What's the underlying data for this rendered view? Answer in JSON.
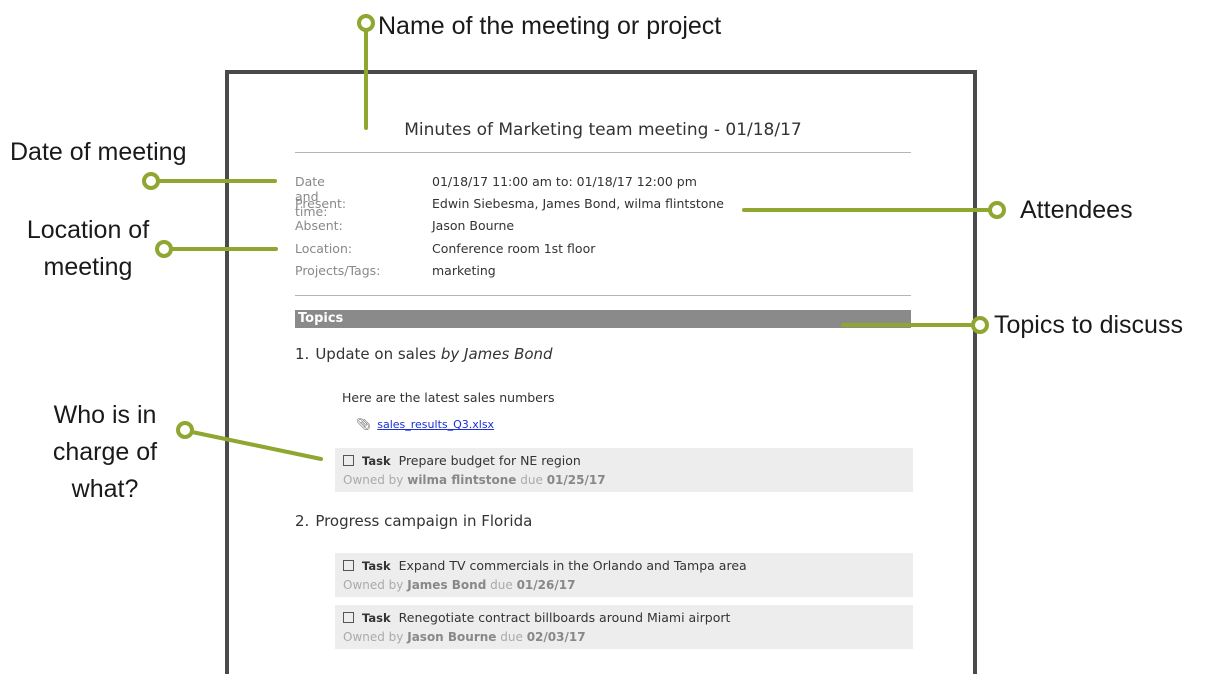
{
  "callouts": {
    "name": "Name of the meeting or project",
    "date": "Date of meeting",
    "location_line1": "Location of",
    "location_line2": "meeting",
    "attendees": "Attendees",
    "topics": "Topics to discuss",
    "who_line1": "Who is in",
    "who_line2": "charge of",
    "who_line3": "what?"
  },
  "colors": {
    "accent": "#8fa631",
    "frame": "#4a4a4a",
    "topics_bar": "#8a8a8a",
    "link": "#1a2fd6"
  },
  "document": {
    "title": "Minutes of Marketing team meeting - 01/18/17",
    "meta": [
      {
        "key": "Date and time:",
        "value": "01/18/17 11:00 am to: 01/18/17 12:00 pm"
      },
      {
        "key": "Present:",
        "value": "Edwin Siebesma, James Bond, wilma flintstone"
      },
      {
        "key": "Absent:",
        "value": "Jason Bourne"
      },
      {
        "key": "Location:",
        "value": "Conference room 1st floor"
      },
      {
        "key": "Projects/Tags:",
        "value": "marketing"
      }
    ],
    "topics_header": "Topics",
    "topics": [
      {
        "number": "1.",
        "title": "Update on sales",
        "by": "by James Bond"
      },
      {
        "number": "2.",
        "title": "Progress campaign in Florida"
      }
    ],
    "note": "Here are the latest sales numbers",
    "attachment": {
      "icon": "paperclip-icon",
      "filename": "sales_results_Q3.xlsx"
    },
    "tasks": [
      {
        "kind": "Task",
        "text": "Prepare budget for NE region",
        "owned_label": "Owned by",
        "owner": "wilma flintstone",
        "due_label": "due",
        "due": "01/25/17"
      },
      {
        "kind": "Task",
        "text": "Expand TV commercials in the Orlando and Tampa area",
        "owned_label": "Owned by",
        "owner": "James Bond",
        "due_label": "due",
        "due": "01/26/17"
      },
      {
        "kind": "Task",
        "text": "Renegotiate contract billboards around Miami airport",
        "owned_label": "Owned by",
        "owner": "Jason Bourne",
        "due_label": "due",
        "due": "02/03/17"
      }
    ]
  }
}
